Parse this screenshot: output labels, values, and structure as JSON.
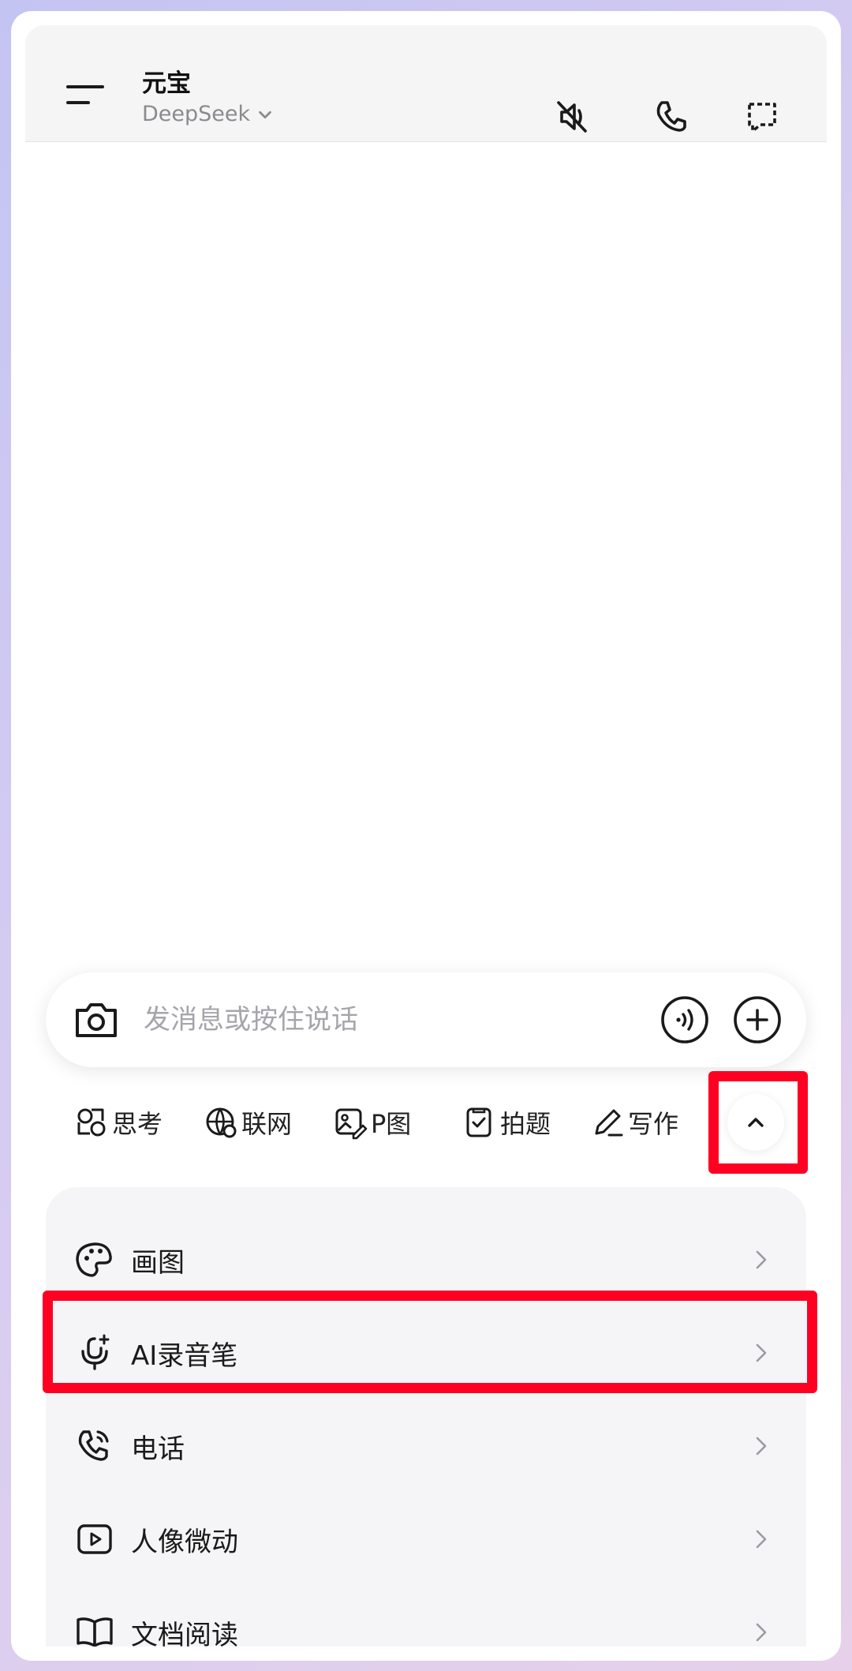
{
  "header": {
    "title": "元宝",
    "model": "DeepSeek",
    "icons": [
      "menu-icon",
      "mute-icon",
      "phone-icon",
      "new-chat-icon"
    ]
  },
  "input": {
    "placeholder": "发消息或按住说话",
    "value": ""
  },
  "tools": [
    {
      "label": "思考",
      "icon": "think-icon"
    },
    {
      "label": "联网",
      "icon": "globe-icon"
    },
    {
      "label": "P图",
      "icon": "image-edit-icon"
    },
    {
      "label": "拍题",
      "icon": "scan-question-icon"
    },
    {
      "label": "写作",
      "icon": "pen-icon"
    }
  ],
  "panel": {
    "items": [
      {
        "label": "画图",
        "icon": "palette-icon"
      },
      {
        "label": "AI录音笔",
        "icon": "recorder-icon"
      },
      {
        "label": "电话",
        "icon": "phone-call-icon"
      },
      {
        "label": "人像微动",
        "icon": "video-play-icon"
      },
      {
        "label": "文档阅读",
        "icon": "book-icon"
      }
    ]
  },
  "highlight_color": "#ff0022"
}
